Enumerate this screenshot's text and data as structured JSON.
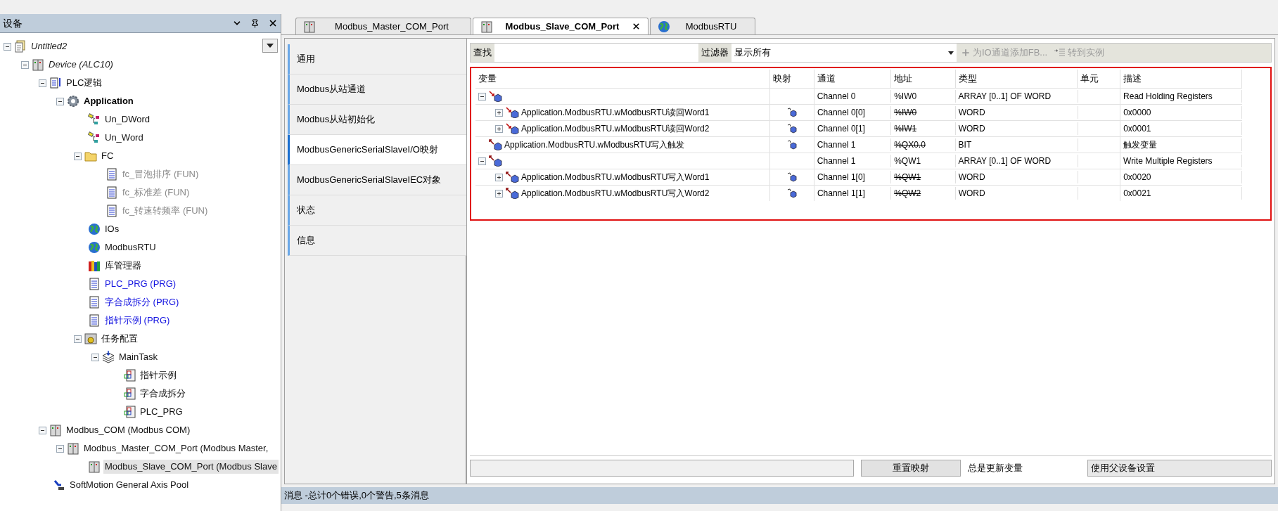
{
  "device_panel": {
    "title": "设备",
    "tree": [
      {
        "label": "Untitled2",
        "kind": "project",
        "expanded": true,
        "selected": false,
        "children": [
          {
            "label": "Device (ALC10)",
            "kind": "controller",
            "expanded": true,
            "selected": false,
            "children": [
              {
                "label": "PLC逻辑",
                "kind": "plc",
                "expanded": true,
                "selected": false,
                "children": [
                  {
                    "label": "Application",
                    "kind": "application",
                    "expanded": true,
                    "selected": false,
                    "children": [
                      {
                        "label": "Un_DWord",
                        "kind": "datatype",
                        "selected": false
                      },
                      {
                        "label": "Un_Word",
                        "kind": "datatype",
                        "selected": false
                      },
                      {
                        "label": "FC",
                        "kind": "folder",
                        "expanded": true,
                        "selected": false,
                        "children": [
                          {
                            "label": "fc_冒泡排序 (FUN)",
                            "kind": "function",
                            "selected": false
                          },
                          {
                            "label": "fc_标准差 (FUN)",
                            "kind": "function",
                            "selected": false
                          },
                          {
                            "label": "fc_转速转频率 (FUN)",
                            "kind": "function",
                            "selected": false
                          }
                        ]
                      },
                      {
                        "label": "IOs",
                        "kind": "globe",
                        "selected": false
                      },
                      {
                        "label": "ModbusRTU",
                        "kind": "globe",
                        "selected": false
                      },
                      {
                        "label": "库管理器",
                        "kind": "library",
                        "selected": false
                      },
                      {
                        "label": "PLC_PRG (PRG)",
                        "kind": "program",
                        "selected": false
                      },
                      {
                        "label": "字合成拆分 (PRG)",
                        "kind": "program",
                        "selected": false
                      },
                      {
                        "label": "指针示例 (PRG)",
                        "kind": "program",
                        "selected": false
                      },
                      {
                        "label": "任务配置",
                        "kind": "taskconfig",
                        "expanded": true,
                        "selected": false,
                        "children": [
                          {
                            "label": "MainTask",
                            "kind": "task",
                            "expanded": true,
                            "selected": false,
                            "children": [
                              {
                                "label": "指针示例",
                                "kind": "call",
                                "selected": false
                              },
                              {
                                "label": "字合成拆分",
                                "kind": "call",
                                "selected": false
                              },
                              {
                                "label": "PLC_PRG",
                                "kind": "call",
                                "selected": false
                              }
                            ]
                          }
                        ]
                      }
                    ]
                  }
                ]
              },
              {
                "label": "Modbus_COM (Modbus COM)",
                "kind": "device",
                "expanded": true,
                "selected": false,
                "children": [
                  {
                    "label": "Modbus_Master_COM_Port (Modbus Master,",
                    "kind": "device",
                    "expanded": true,
                    "selected": false,
                    "children": [
                      {
                        "label": "Modbus_Slave_COM_Port (Modbus Slave",
                        "kind": "device",
                        "selected": true
                      }
                    ]
                  }
                ]
              },
              {
                "label": "SoftMotion General Axis Pool",
                "kind": "softmotion",
                "selected": false
              }
            ]
          }
        ]
      }
    ]
  },
  "editor_tabs": [
    {
      "label": "Modbus_Master_COM_Port",
      "kind": "device",
      "selected": false
    },
    {
      "label": "Modbus_Slave_COM_Port",
      "kind": "device",
      "selected": true
    },
    {
      "label": "ModbusRTU",
      "kind": "globe",
      "selected": false
    }
  ],
  "side_nav": [
    {
      "label": "通用",
      "selected": false
    },
    {
      "label": "Modbus从站通道",
      "selected": false
    },
    {
      "label": "Modbus从站初始化",
      "selected": false
    },
    {
      "label": "ModbusGenericSerialSlaveI/O映射",
      "selected": true
    },
    {
      "label": "ModbusGenericSerialSlaveIEC对象",
      "selected": false
    },
    {
      "label": "状态",
      "selected": false
    },
    {
      "label": "信息",
      "selected": false
    }
  ],
  "toolbar": {
    "find_button": "查找",
    "filter_button": "过滤器",
    "filter_value": "显示所有",
    "actions": [
      {
        "label": "为IO通道添加FB...",
        "kind": "add",
        "disabled": true
      },
      {
        "label": "转到实例",
        "kind": "goto",
        "disabled": true
      }
    ]
  },
  "table": {
    "columns": [
      "变量",
      "映射",
      "通道",
      "地址",
      "类型",
      "单元",
      "描述"
    ],
    "rows": [
      {
        "kind": "input",
        "expanded": true,
        "mapped": false,
        "channel": "Channel 0",
        "address": "%IW0",
        "struck": false,
        "type": "ARRAY [0..1] OF WORD",
        "description": "Read Holding Registers",
        "children": [
          {
            "variable": "Application.ModbusRTU.wModbusRTU读回Word1",
            "kind": "input",
            "expanded": false,
            "mapped": true,
            "channel": "Channel 0[0]",
            "address": "%IW0",
            "struck": true,
            "type": "WORD",
            "description": "0x0000"
          },
          {
            "variable": "Application.ModbusRTU.wModbusRTU读回Word2",
            "kind": "input",
            "expanded": false,
            "mapped": true,
            "channel": "Channel 0[1]",
            "address": "%IW1",
            "struck": true,
            "type": "WORD",
            "description": "0x0001"
          }
        ]
      },
      {
        "variable": "Application.ModbusRTU.wModbusRTU写入触发",
        "kind": "output",
        "mapped": true,
        "channel": "Channel 1",
        "address": "%QX0.0",
        "struck": true,
        "type": "BIT",
        "description": "触发变量"
      },
      {
        "kind": "output",
        "expanded": true,
        "mapped": false,
        "channel": "Channel 1",
        "address": "%QW1",
        "struck": false,
        "type": "ARRAY [0..1] OF WORD",
        "description": "Write Multiple Registers",
        "children": [
          {
            "variable": "Application.ModbusRTU.wModbusRTU写入Word1",
            "kind": "output",
            "expanded": false,
            "mapped": true,
            "channel": "Channel 1[0]",
            "address": "%QW1",
            "struck": true,
            "type": "WORD",
            "description": "0x0020"
          },
          {
            "variable": "Application.ModbusRTU.wModbusRTU写入Word2",
            "kind": "output",
            "expanded": false,
            "mapped": true,
            "channel": "Channel 1[1]",
            "address": "%QW2",
            "struck": true,
            "type": "WORD",
            "description": "0x0021"
          }
        ]
      }
    ]
  },
  "bottom_bar": {
    "reset_button": "重置映射",
    "update_label": "总是更新变量",
    "update_value": "使用父设备设置"
  },
  "status_bar": "消息 -总计0个错误,0个警告,5条消息"
}
